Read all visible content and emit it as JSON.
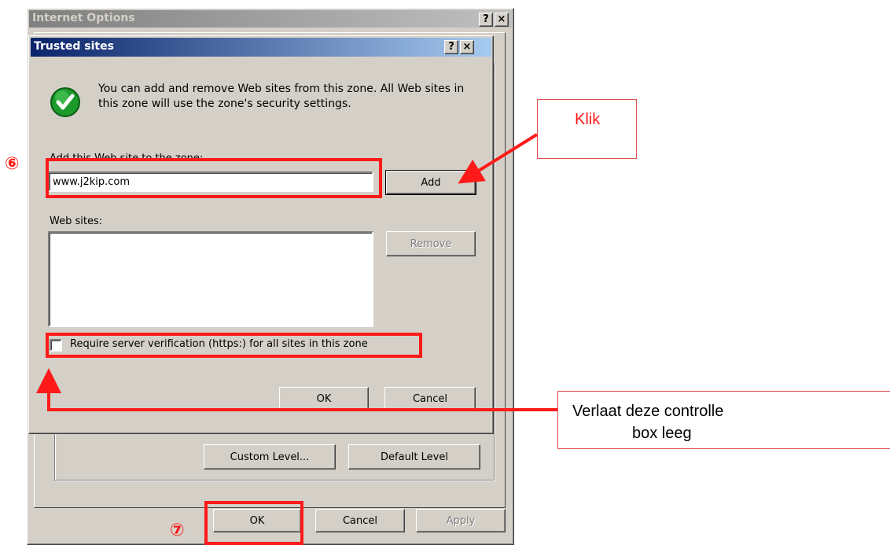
{
  "outer_dialog": {
    "title": "Internet Options",
    "help_btn": "?",
    "close_btn": "×",
    "custom_level": "Custom Level...",
    "default_level": "Default Level",
    "ok": "OK",
    "cancel": "Cancel",
    "apply": "Apply"
  },
  "inner_dialog": {
    "title": "Trusted sites",
    "help_btn": "?",
    "close_btn": "×",
    "info_text": "You can add and remove Web sites from this zone. All Web sites in this zone will use the zone's security settings.",
    "add_label": "Add this Web site to the zone:",
    "site_input_value": "www.j2kip.com",
    "add_button": "Add",
    "websites_label": "Web sites:",
    "remove_button": "Remove",
    "checkbox_label": "Require server verification (https:) for all sites in this zone",
    "checkbox_checked": false,
    "ok": "OK",
    "cancel": "Cancel"
  },
  "annotations": {
    "step6": "⑥",
    "step7": "⑦",
    "klik": "Klik",
    "verlaat_line1": "Verlaat deze controlle",
    "verlaat_line2": "box leeg"
  },
  "colors": {
    "annotation_red": "#ff1a1a",
    "title_active": "#0a246a",
    "dialog_face": "#d4d0c8",
    "check_green": "#1a9a2a"
  }
}
